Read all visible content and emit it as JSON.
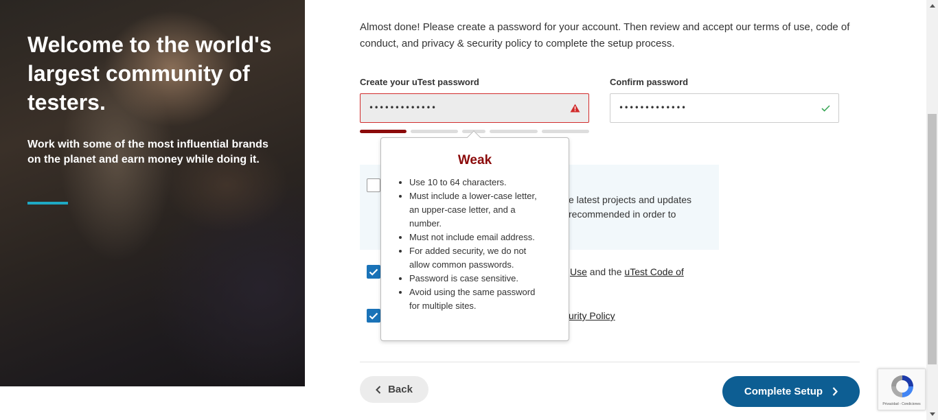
{
  "hero": {
    "title": "Welcome to the world's largest community of testers.",
    "subtitle": "Work with some of the most influential brands on the planet and earn money while doing it."
  },
  "intro": "Almost done! Please create a password for your account. Then review and accept our terms of use, code of conduct, and privacy & security policy to complete the setup process.",
  "password": {
    "label": "Create your uTest password",
    "value": "•••••••••••••",
    "status_icon": "warning-triangle-icon",
    "strength_segments": 5,
    "strength_filled": 1
  },
  "confirm": {
    "label": "Confirm password",
    "value": "•••••••••••••",
    "status_icon": "checkmark-icon"
  },
  "tooltip": {
    "title": "Weak",
    "rules": [
      "Use 10 to 64 characters.",
      "Must include a lower-case letter, an upper-case letter, and a number.",
      "Must not include email address.",
      "For added security, we do not allow common passwords.",
      "Password is case sensitive.",
      "Avoid using the same password for multiple sites."
    ]
  },
  "consent": {
    "visible_text": "e latest projects and updates recommended in order to",
    "checked": false
  },
  "terms": {
    "line1_link1": "Use",
    "line1_and": " and the ",
    "line1_link2": "uTest Code of",
    "line2_link": "urity Policy",
    "checked": true
  },
  "buttons": {
    "back": "Back",
    "complete": "Complete Setup"
  },
  "recaptcha": {
    "footer": "Privacidad - Condiciones"
  },
  "colors": {
    "accent": "#1fa9c4",
    "primary_button": "#0d5e93",
    "weak": "#8b0a0a",
    "checkbox": "#1a73b8"
  }
}
